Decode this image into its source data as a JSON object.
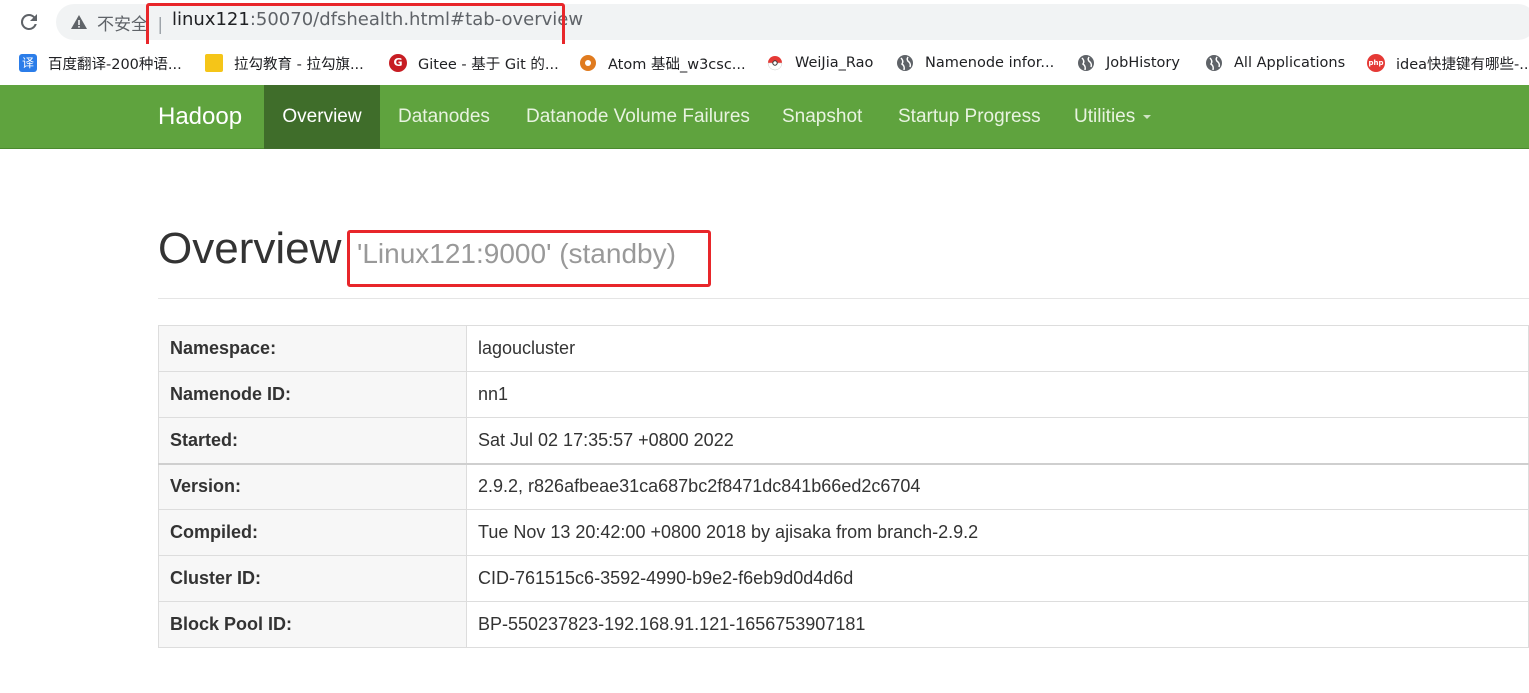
{
  "browser": {
    "insecure_label": "不安全",
    "separator": "|",
    "url_host": "linux121",
    "url_rest": ":50070/dfshealth.html#tab-overview"
  },
  "bookmarks": [
    {
      "label": "百度翻译-200种语...",
      "icon": "translate-icon",
      "color": "#2b7de9"
    },
    {
      "label": "拉勾教育 - 拉勾旗...",
      "icon": "lagou-icon",
      "color": "#f5c518"
    },
    {
      "label": "Gitee - 基于 Git 的...",
      "icon": "gitee-icon",
      "color": "#c71d23"
    },
    {
      "label": "Atom 基础_w3csc...",
      "icon": "atom-icon",
      "color": "#e07b1f"
    },
    {
      "label": "WeiJia_Rao",
      "icon": "pokeball-icon",
      "color": "#e53935"
    },
    {
      "label": "Namenode infor...",
      "icon": "globe-icon",
      "color": "#5f6368"
    },
    {
      "label": "JobHistory",
      "icon": "globe-icon",
      "color": "#5f6368"
    },
    {
      "label": "All Applications",
      "icon": "globe-icon",
      "color": "#5f6368"
    },
    {
      "label": "idea快捷键有哪些-...",
      "icon": "php-icon",
      "color": "#e53935"
    }
  ],
  "navbar": {
    "brand": "Hadoop",
    "items": [
      "Overview",
      "Datanodes",
      "Datanode Volume Failures",
      "Snapshot",
      "Startup Progress",
      "Utilities"
    ],
    "active": "Overview",
    "bg_color": "#5fa33e",
    "active_color": "#3f6d2a"
  },
  "overview": {
    "title": "Overview",
    "subtitle": "'Linux121:9000' (standby)"
  },
  "info_rows": [
    {
      "key": "Namespace:",
      "value": "lagoucluster"
    },
    {
      "key": "Namenode ID:",
      "value": "nn1"
    },
    {
      "key": "Started:",
      "value": "Sat Jul 02 17:35:57 +0800 2022"
    },
    {
      "key": "Version:",
      "value": "2.9.2, r826afbeae31ca687bc2f8471dc841b66ed2c6704"
    },
    {
      "key": "Compiled:",
      "value": "Tue Nov 13 20:42:00 +0800 2018 by ajisaka from branch-2.9.2"
    },
    {
      "key": "Cluster ID:",
      "value": "CID-761515c6-3592-4990-b9e2-f6eb9d0d4d6d"
    },
    {
      "key": "Block Pool ID:",
      "value": "BP-550237823-192.168.91.121-1656753907181"
    }
  ],
  "highlight_color": "#e8262a"
}
